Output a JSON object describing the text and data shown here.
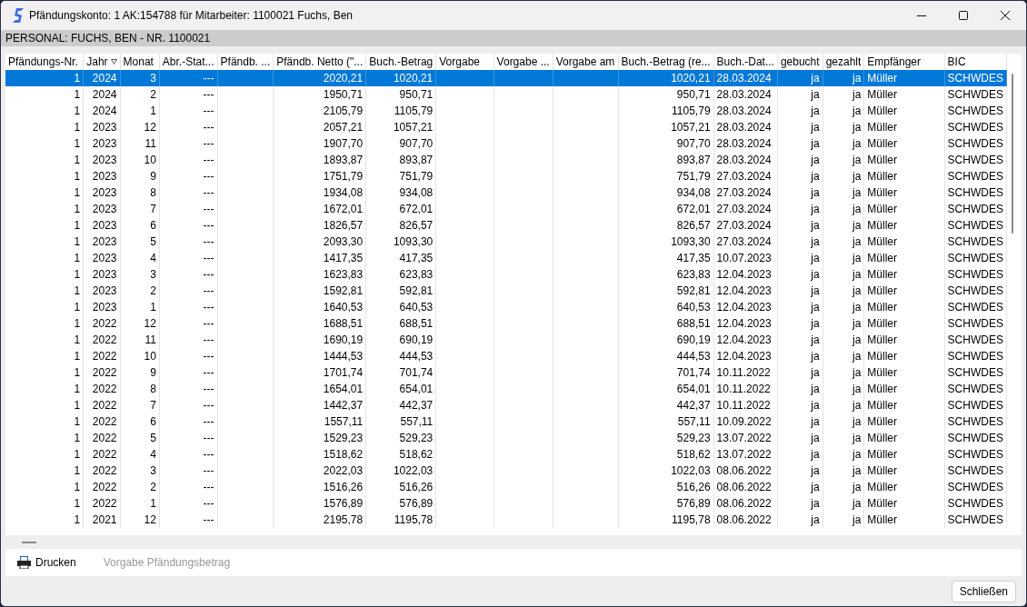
{
  "window": {
    "title": "Pfändungskonto: 1 AK:154788 für Mitarbeiter: 1100021 Fuchs, Ben"
  },
  "header_bar": "PERSONAL: FUCHS, BEN - NR. 1100021",
  "table": {
    "columns": [
      {
        "label": "Pfändungs-Nr.",
        "sorted": false
      },
      {
        "label": "Jahr",
        "sorted": true
      },
      {
        "label": "Monat",
        "sorted": false
      },
      {
        "label": "Abr.-Stat...",
        "sorted": false
      },
      {
        "label": "Pfändb. ...",
        "sorted": false
      },
      {
        "label": "Pfändb. Netto (\"...",
        "sorted": false
      },
      {
        "label": "Buch.-Betrag",
        "sorted": false
      },
      {
        "label": "Vorgabe",
        "sorted": false
      },
      {
        "label": "Vorgabe ...",
        "sorted": false
      },
      {
        "label": "Vorgabe am",
        "sorted": false
      },
      {
        "label": "Buch.-Betrag (re...",
        "sorted": false
      },
      {
        "label": "Buch.-Dat...",
        "sorted": false
      },
      {
        "label": "gebucht",
        "sorted": false
      },
      {
        "label": "gezahlt",
        "sorted": false
      },
      {
        "label": "Empfänger",
        "sorted": false
      },
      {
        "label": "BIC",
        "sorted": false
      }
    ],
    "rows": [
      {
        "selected": true,
        "cells": [
          "1",
          "2024",
          "3",
          "---",
          null,
          "2020,21",
          "1020,21",
          null,
          null,
          null,
          "1020,21",
          "28.03.2024",
          "ja",
          "ja",
          "Müller",
          "SCHWDES"
        ]
      },
      {
        "selected": false,
        "cells": [
          "1",
          "2024",
          "2",
          "---",
          null,
          "1950,71",
          "950,71",
          null,
          null,
          null,
          "950,71",
          "28.03.2024",
          "ja",
          "ja",
          "Müller",
          "SCHWDES"
        ]
      },
      {
        "selected": false,
        "cells": [
          "1",
          "2024",
          "1",
          "---",
          null,
          "2105,79",
          "1105,79",
          null,
          null,
          null,
          "1105,79",
          "28.03.2024",
          "ja",
          "ja",
          "Müller",
          "SCHWDES"
        ]
      },
      {
        "selected": false,
        "cells": [
          "1",
          "2023",
          "12",
          "---",
          null,
          "2057,21",
          "1057,21",
          null,
          null,
          null,
          "1057,21",
          "28.03.2024",
          "ja",
          "ja",
          "Müller",
          "SCHWDES"
        ]
      },
      {
        "selected": false,
        "cells": [
          "1",
          "2023",
          "11",
          "---",
          null,
          "1907,70",
          "907,70",
          null,
          null,
          null,
          "907,70",
          "28.03.2024",
          "ja",
          "ja",
          "Müller",
          "SCHWDES"
        ]
      },
      {
        "selected": false,
        "cells": [
          "1",
          "2023",
          "10",
          "---",
          null,
          "1893,87",
          "893,87",
          null,
          null,
          null,
          "893,87",
          "28.03.2024",
          "ja",
          "ja",
          "Müller",
          "SCHWDES"
        ]
      },
      {
        "selected": false,
        "cells": [
          "1",
          "2023",
          "9",
          "---",
          null,
          "1751,79",
          "751,79",
          null,
          null,
          null,
          "751,79",
          "27.03.2024",
          "ja",
          "ja",
          "Müller",
          "SCHWDES"
        ]
      },
      {
        "selected": false,
        "cells": [
          "1",
          "2023",
          "8",
          "---",
          null,
          "1934,08",
          "934,08",
          null,
          null,
          null,
          "934,08",
          "27.03.2024",
          "ja",
          "ja",
          "Müller",
          "SCHWDES"
        ]
      },
      {
        "selected": false,
        "cells": [
          "1",
          "2023",
          "7",
          "---",
          null,
          "1672,01",
          "672,01",
          null,
          null,
          null,
          "672,01",
          "27.03.2024",
          "ja",
          "ja",
          "Müller",
          "SCHWDES"
        ]
      },
      {
        "selected": false,
        "cells": [
          "1",
          "2023",
          "6",
          "---",
          null,
          "1826,57",
          "826,57",
          null,
          null,
          null,
          "826,57",
          "27.03.2024",
          "ja",
          "ja",
          "Müller",
          "SCHWDES"
        ]
      },
      {
        "selected": false,
        "cells": [
          "1",
          "2023",
          "5",
          "---",
          null,
          "2093,30",
          "1093,30",
          null,
          null,
          null,
          "1093,30",
          "27.03.2024",
          "ja",
          "ja",
          "Müller",
          "SCHWDES"
        ]
      },
      {
        "selected": false,
        "cells": [
          "1",
          "2023",
          "4",
          "---",
          null,
          "1417,35",
          "417,35",
          null,
          null,
          null,
          "417,35",
          "10.07.2023",
          "ja",
          "ja",
          "Müller",
          "SCHWDES"
        ]
      },
      {
        "selected": false,
        "cells": [
          "1",
          "2023",
          "3",
          "---",
          null,
          "1623,83",
          "623,83",
          null,
          null,
          null,
          "623,83",
          "12.04.2023",
          "ja",
          "ja",
          "Müller",
          "SCHWDES"
        ]
      },
      {
        "selected": false,
        "cells": [
          "1",
          "2023",
          "2",
          "---",
          null,
          "1592,81",
          "592,81",
          null,
          null,
          null,
          "592,81",
          "12.04.2023",
          "ja",
          "ja",
          "Müller",
          "SCHWDES"
        ]
      },
      {
        "selected": false,
        "cells": [
          "1",
          "2023",
          "1",
          "---",
          null,
          "1640,53",
          "640,53",
          null,
          null,
          null,
          "640,53",
          "12.04.2023",
          "ja",
          "ja",
          "Müller",
          "SCHWDES"
        ]
      },
      {
        "selected": false,
        "cells": [
          "1",
          "2022",
          "12",
          "---",
          null,
          "1688,51",
          "688,51",
          null,
          null,
          null,
          "688,51",
          "12.04.2023",
          "ja",
          "ja",
          "Müller",
          "SCHWDES"
        ]
      },
      {
        "selected": false,
        "cells": [
          "1",
          "2022",
          "11",
          "---",
          null,
          "1690,19",
          "690,19",
          null,
          null,
          null,
          "690,19",
          "12.04.2023",
          "ja",
          "ja",
          "Müller",
          "SCHWDES"
        ]
      },
      {
        "selected": false,
        "cells": [
          "1",
          "2022",
          "10",
          "---",
          null,
          "1444,53",
          "444,53",
          null,
          null,
          null,
          "444,53",
          "12.04.2023",
          "ja",
          "ja",
          "Müller",
          "SCHWDES"
        ]
      },
      {
        "selected": false,
        "cells": [
          "1",
          "2022",
          "9",
          "---",
          null,
          "1701,74",
          "701,74",
          null,
          null,
          null,
          "701,74",
          "10.11.2022",
          "ja",
          "ja",
          "Müller",
          "SCHWDES"
        ]
      },
      {
        "selected": false,
        "cells": [
          "1",
          "2022",
          "8",
          "---",
          null,
          "1654,01",
          "654,01",
          null,
          null,
          null,
          "654,01",
          "10.11.2022",
          "ja",
          "ja",
          "Müller",
          "SCHWDES"
        ]
      },
      {
        "selected": false,
        "cells": [
          "1",
          "2022",
          "7",
          "---",
          null,
          "1442,37",
          "442,37",
          null,
          null,
          null,
          "442,37",
          "10.11.2022",
          "ja",
          "ja",
          "Müller",
          "SCHWDES"
        ]
      },
      {
        "selected": false,
        "cells": [
          "1",
          "2022",
          "6",
          "---",
          null,
          "1557,11",
          "557,11",
          null,
          null,
          null,
          "557,11",
          "10.09.2022",
          "ja",
          "ja",
          "Müller",
          "SCHWDES"
        ]
      },
      {
        "selected": false,
        "cells": [
          "1",
          "2022",
          "5",
          "---",
          null,
          "1529,23",
          "529,23",
          null,
          null,
          null,
          "529,23",
          "13.07.2022",
          "ja",
          "ja",
          "Müller",
          "SCHWDES"
        ]
      },
      {
        "selected": false,
        "cells": [
          "1",
          "2022",
          "4",
          "---",
          null,
          "1518,62",
          "518,62",
          null,
          null,
          null,
          "518,62",
          "13.07.2022",
          "ja",
          "ja",
          "Müller",
          "SCHWDES"
        ]
      },
      {
        "selected": false,
        "cells": [
          "1",
          "2022",
          "3",
          "---",
          null,
          "2022,03",
          "1022,03",
          null,
          null,
          null,
          "1022,03",
          "08.06.2022",
          "ja",
          "ja",
          "Müller",
          "SCHWDES"
        ]
      },
      {
        "selected": false,
        "cells": [
          "1",
          "2022",
          "2",
          "---",
          null,
          "1516,26",
          "516,26",
          null,
          null,
          null,
          "516,26",
          "08.06.2022",
          "ja",
          "ja",
          "Müller",
          "SCHWDES"
        ]
      },
      {
        "selected": false,
        "cells": [
          "1",
          "2022",
          "1",
          "---",
          null,
          "1576,89",
          "576,89",
          null,
          null,
          null,
          "576,89",
          "08.06.2022",
          "ja",
          "ja",
          "Müller",
          "SCHWDES"
        ]
      },
      {
        "selected": false,
        "cells": [
          "1",
          "2021",
          "12",
          "---",
          null,
          "2195,78",
          "1195,78",
          null,
          null,
          null,
          "1195,78",
          "08.06.2022",
          "ja",
          "ja",
          "Müller",
          "SCHWDES"
        ]
      }
    ]
  },
  "toolbar": [
    {
      "label": "Drucken",
      "disabled": false
    },
    {
      "label": "Vorgabe Pfändungsbetrag",
      "disabled": true
    }
  ],
  "buttons": [
    "Schließen"
  ]
}
